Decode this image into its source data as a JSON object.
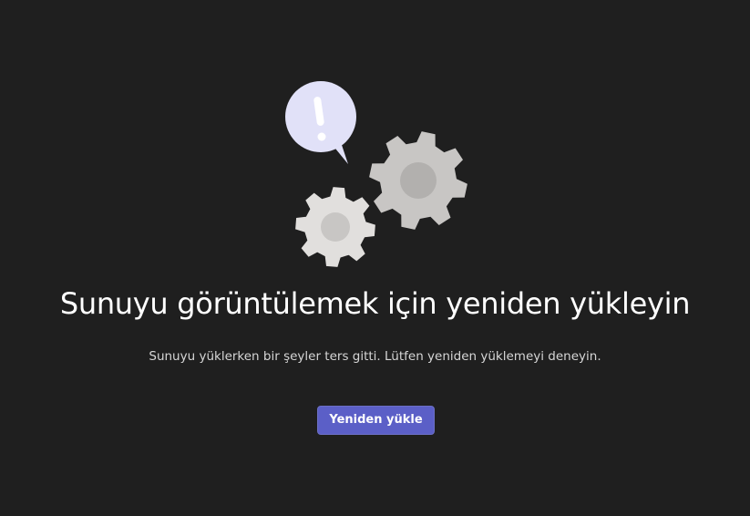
{
  "illustration": {
    "icons": [
      "exclamation-bubble-icon",
      "gear-icon",
      "gear-icon"
    ],
    "colors": {
      "bubble": "#e1e1f8",
      "exclamation": "#ffffff",
      "gear_large": "#c8c6c4",
      "gear_large_hub": "#b2b0ae",
      "gear_small": "#e1dfdd",
      "gear_small_hub": "#c8c6c4"
    }
  },
  "error": {
    "title": "Sunuyu görüntülemek için yeniden yükleyin",
    "message": "Sunuyu yüklerken bir şeyler ters gitti. Lütfen yeniden yüklemeyi deneyin.",
    "reload_button_label": "Yeniden yükle"
  },
  "colors": {
    "background": "#1f1f1f",
    "accent": "#5b5fc7"
  }
}
